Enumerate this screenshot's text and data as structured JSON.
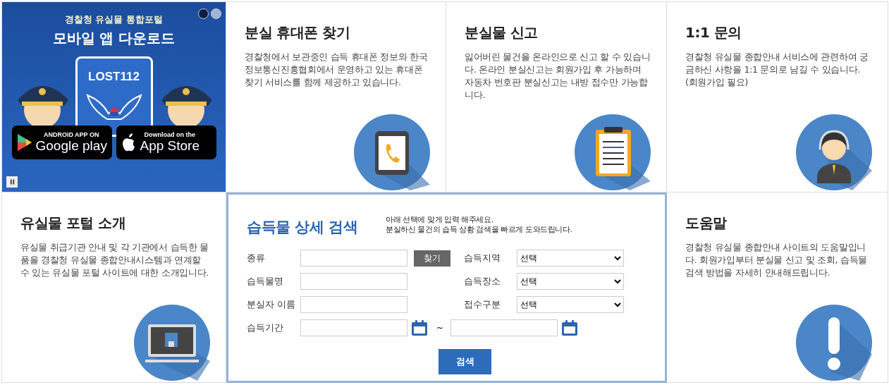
{
  "banner": {
    "subtitle": "경찰청 유실물 통합포털",
    "title": "모바일 앱 다운로드",
    "app_name": "LOST112",
    "slides": [
      {
        "selected": true
      },
      {
        "selected": false
      }
    ],
    "stores": [
      {
        "kind": "google",
        "small": "ANDROID APP ON",
        "big": "Google play"
      },
      {
        "kind": "apple",
        "small": "Download on the",
        "big": "App Store"
      }
    ]
  },
  "cards": [
    {
      "kind": "phone",
      "title": "분실 휴대폰 찾기",
      "text": "경찰청에서 보관중인 습득 휴대폰 정보와 한국정보통신진흥협회에서 운영하고 있는 휴대폰 찾기 서비스를 함께 제공하고 있습니다."
    },
    {
      "kind": "clipboard",
      "title": "분실물 신고",
      "text": "잃어버린 물건을 온라인으로 신고 할 수 있습니다. 온라인 분실신고는 회원가입 후 가능하며 자동차 번호판 분실신고는 내방 접수만 가능합니다."
    },
    {
      "kind": "agent",
      "title": "1:1 문의",
      "text": "경찰청 유실물 종합안내 서비스에 관련하여 궁금하신 사항을 1:1 문의로 남길 수 있습니다. (회원가입 필요)"
    },
    {
      "kind": "monitor",
      "title": "유실물 포털 소개",
      "text": "유실물 취급기관 안내 및 각 기관에서 습득한 물품을 경찰청 유실물 종합안내시스템과 연계할 수 있는 유실물 포털 사이트에 대한 소개입니다."
    },
    {
      "kind": "help",
      "title": "도움말",
      "text": "경찰청 유실물 종합안내 사이트의 도움말입니다. 회원가입부터 분실물 신고 및 조회, 습득물 검색 방법을 자세히 안내해드립니다."
    }
  ],
  "search": {
    "title": "습득물 상세 검색",
    "hints": [
      "아래 선택에 맞게 입력 해주세요.",
      "분실하신 물건의 습득 상황 검색을 빠르게 도와드립니다."
    ],
    "fields": [
      {
        "label": "종류",
        "button": "찾기"
      },
      {
        "label": "습득물명"
      },
      {
        "label": "분실자 이름"
      }
    ],
    "selects": [
      {
        "label": "습득지역",
        "value": "선택"
      },
      {
        "label": "습득장소",
        "value": "선택"
      },
      {
        "label": "접수구분",
        "value": "선택"
      }
    ],
    "period": {
      "label": "습득기간",
      "separator": "~"
    },
    "submit": "검색"
  }
}
